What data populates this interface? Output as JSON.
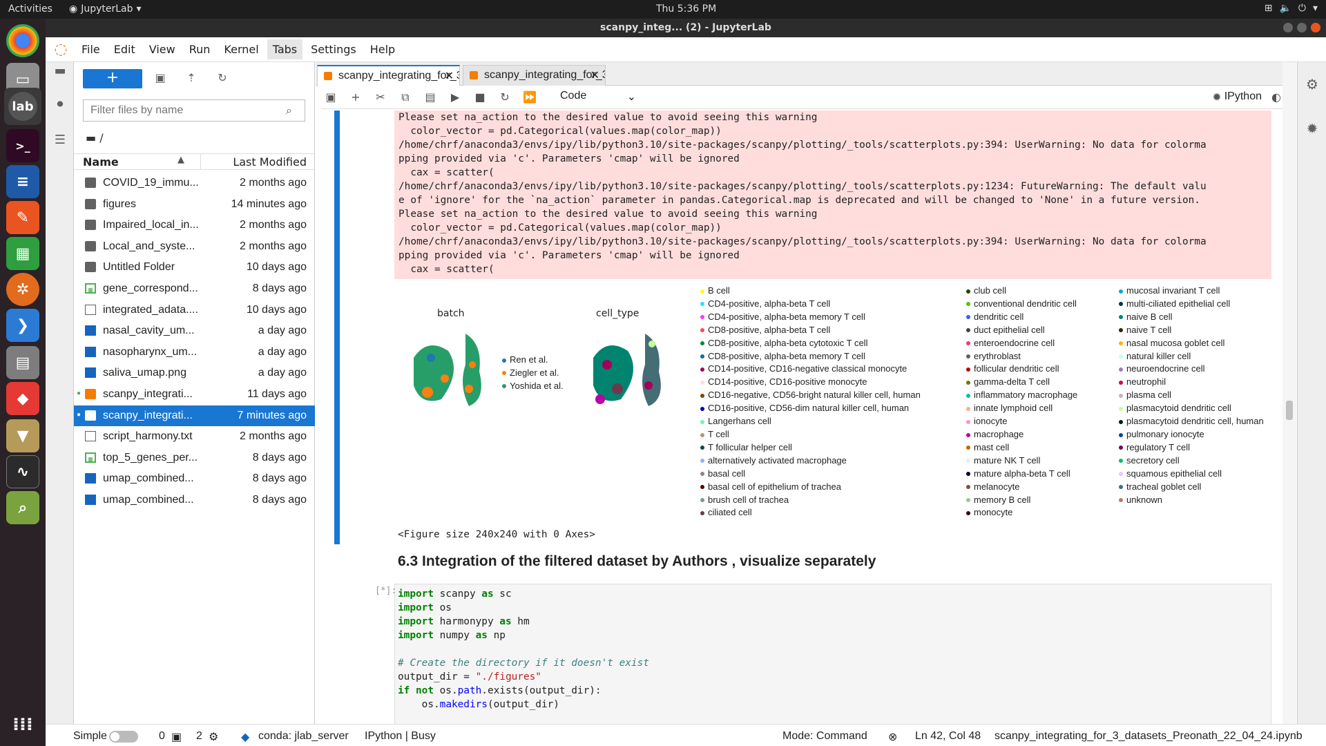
{
  "system": {
    "activities": "Activities",
    "app_name": "JupyterLab",
    "clock": "Thu  5:36 PM",
    "window_title": "scanpy_integ... (2) - JupyterLab"
  },
  "menu": [
    "File",
    "Edit",
    "View",
    "Run",
    "Kernel",
    "Tabs",
    "Settings",
    "Help"
  ],
  "filebrowser": {
    "search_placeholder": "Filter files by name",
    "breadcrumb": "/",
    "col_name": "Name",
    "col_modified": "Last Modified",
    "files": [
      {
        "name": "COVID_19_immu...",
        "modified": "2 months ago",
        "type": "folder"
      },
      {
        "name": "figures",
        "modified": "14 minutes ago",
        "type": "folder"
      },
      {
        "name": "Impaired_local_in...",
        "modified": "2 months ago",
        "type": "folder"
      },
      {
        "name": "Local_and_syste...",
        "modified": "2 months ago",
        "type": "folder"
      },
      {
        "name": "Untitled Folder",
        "modified": "10 days ago",
        "type": "folder"
      },
      {
        "name": "gene_correspond...",
        "modified": "8 days ago",
        "type": "csv"
      },
      {
        "name": "integrated_adata....",
        "modified": "10 days ago",
        "type": "file"
      },
      {
        "name": "nasal_cavity_um...",
        "modified": "a day ago",
        "type": "img"
      },
      {
        "name": "nasopharynx_um...",
        "modified": "a day ago",
        "type": "img"
      },
      {
        "name": "saliva_umap.png",
        "modified": "a day ago",
        "type": "img"
      },
      {
        "name": "scanpy_integrati...",
        "modified": "11 days ago",
        "type": "nb"
      },
      {
        "name": "scanpy_integrati...",
        "modified": "7 minutes ago",
        "type": "nb"
      },
      {
        "name": "script_harmony.txt",
        "modified": "2 months ago",
        "type": "file"
      },
      {
        "name": "top_5_genes_per...",
        "modified": "8 days ago",
        "type": "csv"
      },
      {
        "name": "umap_combined...",
        "modified": "8 days ago",
        "type": "img"
      },
      {
        "name": "umap_combined...",
        "modified": "8 days ago",
        "type": "img"
      }
    ]
  },
  "tabs": [
    "scanpy_integrating_for_3_d",
    "scanpy_integrating_for_3_d"
  ],
  "toolbar": {
    "cell_type": "Code",
    "kernel": "IPython"
  },
  "stderr_lines": [
    "Please set na_action to the desired value to avoid seeing this warning",
    "  color_vector = pd.Categorical(values.map(color_map))",
    "/home/chrf/anaconda3/envs/ipy/lib/python3.10/site-packages/scanpy/plotting/_tools/scatterplots.py:394: UserWarning: No data for colorma",
    "pping provided via 'c'. Parameters 'cmap' will be ignored",
    "  cax = scatter(",
    "/home/chrf/anaconda3/envs/ipy/lib/python3.10/site-packages/scanpy/plotting/_tools/scatterplots.py:1234: FutureWarning: The default valu",
    "e of 'ignore' for the `na_action` parameter in pandas.Categorical.map is deprecated and will be changed to 'None' in a future version.",
    "Please set na_action to the desired value to avoid seeing this warning",
    "  color_vector = pd.Categorical(values.map(color_map))",
    "/home/chrf/anaconda3/envs/ipy/lib/python3.10/site-packages/scanpy/plotting/_tools/scatterplots.py:394: UserWarning: No data for colorma",
    "pping provided via 'c'. Parameters 'cmap' will be ignored",
    "  cax = scatter("
  ],
  "plot": {
    "title_batch": "batch",
    "title_celltype": "cell_type",
    "batch_legend": [
      {
        "label": "Ren et al.",
        "color": "#1f77b4"
      },
      {
        "label": "Ziegler et al.",
        "color": "#ff7f0e"
      },
      {
        "label": "Yoshida et al.",
        "color": "#279e68"
      }
    ],
    "celltype_legend": [
      [
        {
          "label": "B cell",
          "color": "#ffff00"
        },
        {
          "label": "CD4-positive, alpha-beta T cell",
          "color": "#1ce6ff"
        },
        {
          "label": "CD4-positive, alpha-beta memory T cell",
          "color": "#ff34ff"
        },
        {
          "label": "CD8-positive, alpha-beta T cell",
          "color": "#ff4a46"
        },
        {
          "label": "CD8-positive, alpha-beta cytotoxic T cell",
          "color": "#008941"
        },
        {
          "label": "CD8-positive, alpha-beta memory T cell",
          "color": "#006fa6"
        },
        {
          "label": "CD14-positive, CD16-negative classical monocyte",
          "color": "#a30059"
        },
        {
          "label": "CD14-positive, CD16-positive monocyte",
          "color": "#ffdbe5"
        },
        {
          "label": "CD16-negative, CD56-bright natural killer cell, human",
          "color": "#7a4900"
        },
        {
          "label": "CD16-positive, CD56-dim natural killer cell, human",
          "color": "#0000a6"
        },
        {
          "label": "Langerhans cell",
          "color": "#63ffac"
        },
        {
          "label": "T cell",
          "color": "#b79762"
        },
        {
          "label": "T follicular helper cell",
          "color": "#004d43"
        },
        {
          "label": "alternatively activated macrophage",
          "color": "#8fb0ff"
        },
        {
          "label": "basal cell",
          "color": "#997d87"
        },
        {
          "label": "basal cell of epithelium of trachea",
          "color": "#5a0007"
        },
        {
          "label": "brush cell of trachea",
          "color": "#809693"
        },
        {
          "label": "ciliated cell",
          "color": "#6a3a4c"
        }
      ],
      [
        {
          "label": "club cell",
          "color": "#1b4400"
        },
        {
          "label": "conventional dendritic cell",
          "color": "#4fc601"
        },
        {
          "label": "dendritic cell",
          "color": "#3b5dff"
        },
        {
          "label": "duct epithelial cell",
          "color": "#4a3b53"
        },
        {
          "label": "enteroendocrine cell",
          "color": "#ff2f80"
        },
        {
          "label": "erythroblast",
          "color": "#61615a"
        },
        {
          "label": "follicular dendritic cell",
          "color": "#ba0900"
        },
        {
          "label": "gamma-delta T cell",
          "color": "#6b7900"
        },
        {
          "label": "inflammatory macrophage",
          "color": "#00c2a0"
        },
        {
          "label": "innate lymphoid cell",
          "color": "#ffaa92"
        },
        {
          "label": "ionocyte",
          "color": "#ff90c9"
        },
        {
          "label": "macrophage",
          "color": "#b903aa"
        },
        {
          "label": "mast cell",
          "color": "#d16100"
        },
        {
          "label": "mature NK T cell",
          "color": "#ddefff"
        },
        {
          "label": "mature alpha-beta T cell",
          "color": "#000035"
        },
        {
          "label": "melanocyte",
          "color": "#7b4f4b"
        },
        {
          "label": "memory B cell",
          "color": "#a1c299"
        },
        {
          "label": "monocyte",
          "color": "#300018"
        }
      ],
      [
        {
          "label": "mucosal invariant T cell",
          "color": "#0aa6d8"
        },
        {
          "label": "multi-ciliated epithelial cell",
          "color": "#013349"
        },
        {
          "label": "naive B cell",
          "color": "#00846f"
        },
        {
          "label": "naive T cell",
          "color": "#372101"
        },
        {
          "label": "nasal mucosa goblet cell",
          "color": "#ffb500"
        },
        {
          "label": "natural killer cell",
          "color": "#c2ffed"
        },
        {
          "label": "neuroendocrine cell",
          "color": "#a079bf"
        },
        {
          "label": "neutrophil",
          "color": "#cc0744"
        },
        {
          "label": "plasma cell",
          "color": "#c0b9b2"
        },
        {
          "label": "plasmacytoid dendritic cell",
          "color": "#c2ff99"
        },
        {
          "label": "plasmacytoid dendritic cell, human",
          "color": "#001e09"
        },
        {
          "label": "pulmonary ionocyte",
          "color": "#00489c"
        },
        {
          "label": "regulatory T cell",
          "color": "#6f0062"
        },
        {
          "label": "secretory cell",
          "color": "#0cbd66"
        },
        {
          "label": "squamous epithelial cell",
          "color": "#eec3ff"
        },
        {
          "label": "tracheal goblet cell",
          "color": "#456d75"
        },
        {
          "label": "unknown",
          "color": "#b77b68"
        }
      ]
    ]
  },
  "figure_size": "<Figure size 240x240 with 0 Axes>",
  "heading": "6.3 Integration of the filtered dataset by Authors , visualize separately",
  "code_prompt": "[*]:",
  "status": {
    "mode_label": "Simple",
    "terminals": "0",
    "kernels": "2",
    "conda": "conda: jlab_server",
    "kernel_status": "IPython | Busy",
    "mode": "Mode: Command",
    "position": "Ln 42, Col 48",
    "filename": "scanpy_integrating_for_3_datasets_Preonath_22_04_24.ipynb"
  }
}
